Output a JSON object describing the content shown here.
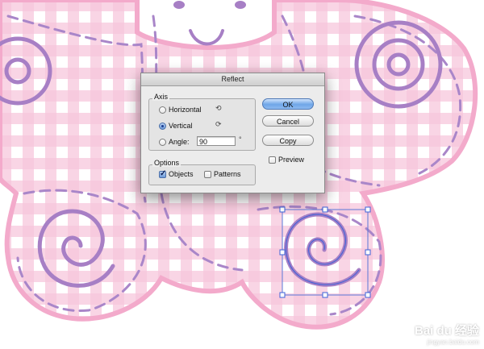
{
  "dialog": {
    "title": "Reflect",
    "axis_group_label": "Axis",
    "horizontal_label": "Horizontal",
    "vertical_label": "Vertical",
    "angle_label": "Angle:",
    "angle_value": "90",
    "degree_symbol": "°",
    "options_group_label": "Options",
    "objects_label": "Objects",
    "patterns_label": "Patterns",
    "ok_label": "OK",
    "cancel_label": "Cancel",
    "copy_label": "Copy",
    "preview_label": "Preview",
    "selected_axis": "vertical",
    "objects_checked": true,
    "patterns_checked": false,
    "preview_checked": false
  },
  "watermark": {
    "brand": "Bai du 经验",
    "site": "jingyan.baidu.com"
  },
  "colors": {
    "gingham_pink": "#f6bfd8",
    "gingham_light": "#fce3ee",
    "outline_pink": "#f1a7c9",
    "purple": "#a77fc5",
    "selection_blue": "#3d63d8"
  }
}
